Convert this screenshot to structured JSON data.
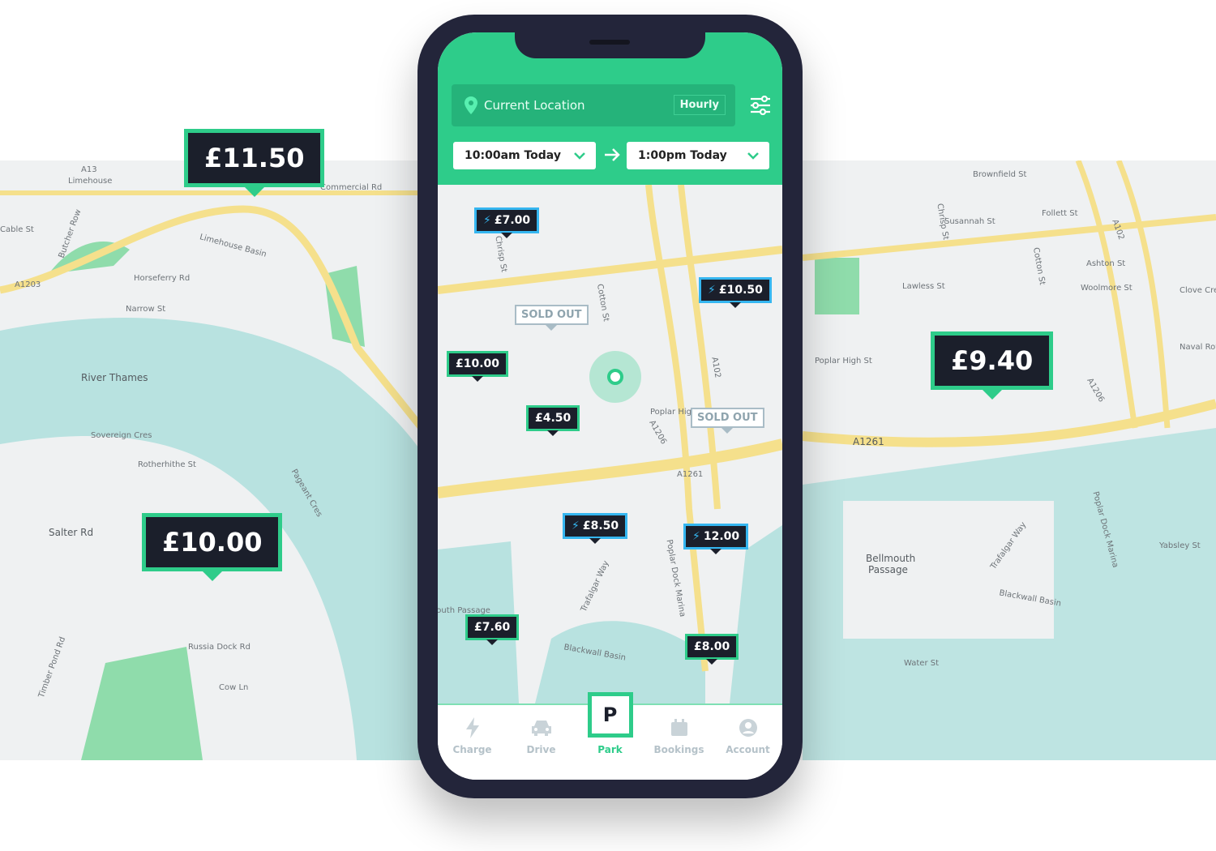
{
  "colors": {
    "brand": "#2ecc8a",
    "charge_border": "#35b6f0",
    "pin_bg": "#1b1f2b",
    "water": "#b8e2e0",
    "road": "#f5e08c",
    "park": "#8fdcab"
  },
  "background_map": {
    "labels": [
      "A13",
      "Limehouse",
      "Commercial Rd",
      "Cable St",
      "Butcher Row",
      "A1203",
      "Limehouse Basin",
      "Horseferry Rd",
      "Narrow St",
      "River Thames",
      "Sovereign Cres",
      "Rotherhithe St",
      "Salter Rd",
      "Pageant Cres",
      "Russia Dock Rd",
      "Cow Ln",
      "Timber Pond Rd",
      "Brownfield St",
      "Chrisp St",
      "Cotton St",
      "A102",
      "Susannah St",
      "Follett St",
      "Lawless St",
      "Woolmore St",
      "Ashton St",
      "Poplar High St",
      "A1261",
      "A1206",
      "Clove Cres",
      "Bellmouth Passage",
      "Blackwall Basin",
      "Poplar Dock Marina",
      "Naval Row",
      "Yabsley St",
      "Trafalgar Way",
      "Water St"
    ],
    "price_pins": [
      {
        "price": "£11.50"
      },
      {
        "price": "£10.00"
      },
      {
        "price": "£9.40"
      }
    ]
  },
  "app": {
    "search": {
      "location": "Current Location",
      "mode": "Hourly",
      "location_icon": "map-pin-icon",
      "filter_icon": "sliders-icon"
    },
    "time": {
      "start": "10:00am Today",
      "end": "1:00pm Today"
    },
    "map": {
      "labels": [
        "Chrisp St",
        "Cotton St",
        "A102",
        "A1206",
        "A1261",
        "Poplar High St",
        "Blackwall Basin",
        "Poplar Dock Marina",
        "Trafalgar Way",
        "Bellmouth Passage"
      ],
      "pins": [
        {
          "price": "£7.00",
          "charging": true
        },
        {
          "price": "£10.50",
          "charging": true
        },
        {
          "price": "SOLD OUT",
          "sold_out": true
        },
        {
          "price": "SOLD OUT",
          "sold_out": true
        },
        {
          "price": "£10.00",
          "charging": false
        },
        {
          "price": "£4.50",
          "charging": false
        },
        {
          "price": "£8.50",
          "charging": true
        },
        {
          "price": "12.00",
          "charging": true
        },
        {
          "price": "£7.60",
          "charging": false
        },
        {
          "price": "£8.00",
          "charging": false
        }
      ]
    },
    "tabs": [
      {
        "label": "Charge",
        "icon": "bolt-icon"
      },
      {
        "label": "Drive",
        "icon": "car-icon"
      },
      {
        "label": "Park",
        "icon": "parking-icon",
        "active": true
      },
      {
        "label": "Bookings",
        "icon": "calendar-icon"
      },
      {
        "label": "Account",
        "icon": "user-icon"
      }
    ],
    "park_glyph": "P"
  }
}
